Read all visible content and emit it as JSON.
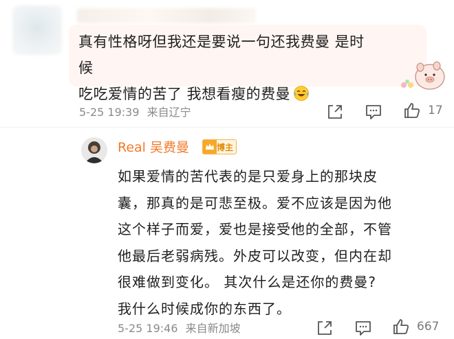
{
  "top_comment": {
    "text_line1": "真有性格呀但我还是要说一句还我费曼 是时候",
    "text_line2": "吃吃爱情的苦了 我想看瘦的费曼",
    "emoji": "laugh-cry-icon",
    "sticker": "pig-sticker",
    "timestamp": "5-25 19:39",
    "location": "来自辽宁",
    "like_count": "17"
  },
  "reply": {
    "author": "Real 吴费曼",
    "badge": "博主",
    "lines": [
      "如果爱情的苦代表的是只爱身上的那块皮",
      "囊，那真的是可悲至极。爱不应该是因为他",
      "这个样子而爱，爱也是接受他的全部，不管",
      "他最后老弱病残。外皮可以改变，但内在却",
      "很难做到变化。 其次什么是还你的费曼?",
      "我什么时候成你的东西了。"
    ],
    "timestamp": "5-25 19:46",
    "location": "来自新加坡",
    "like_count": "667"
  },
  "icons": {
    "share": "share-icon",
    "comment": "comment-icon",
    "like": "thumbs-up-icon"
  },
  "colors": {
    "author_name": "#f27a29",
    "bubble_bg": "#fff5f2",
    "meta_text": "#8a8a8a"
  }
}
